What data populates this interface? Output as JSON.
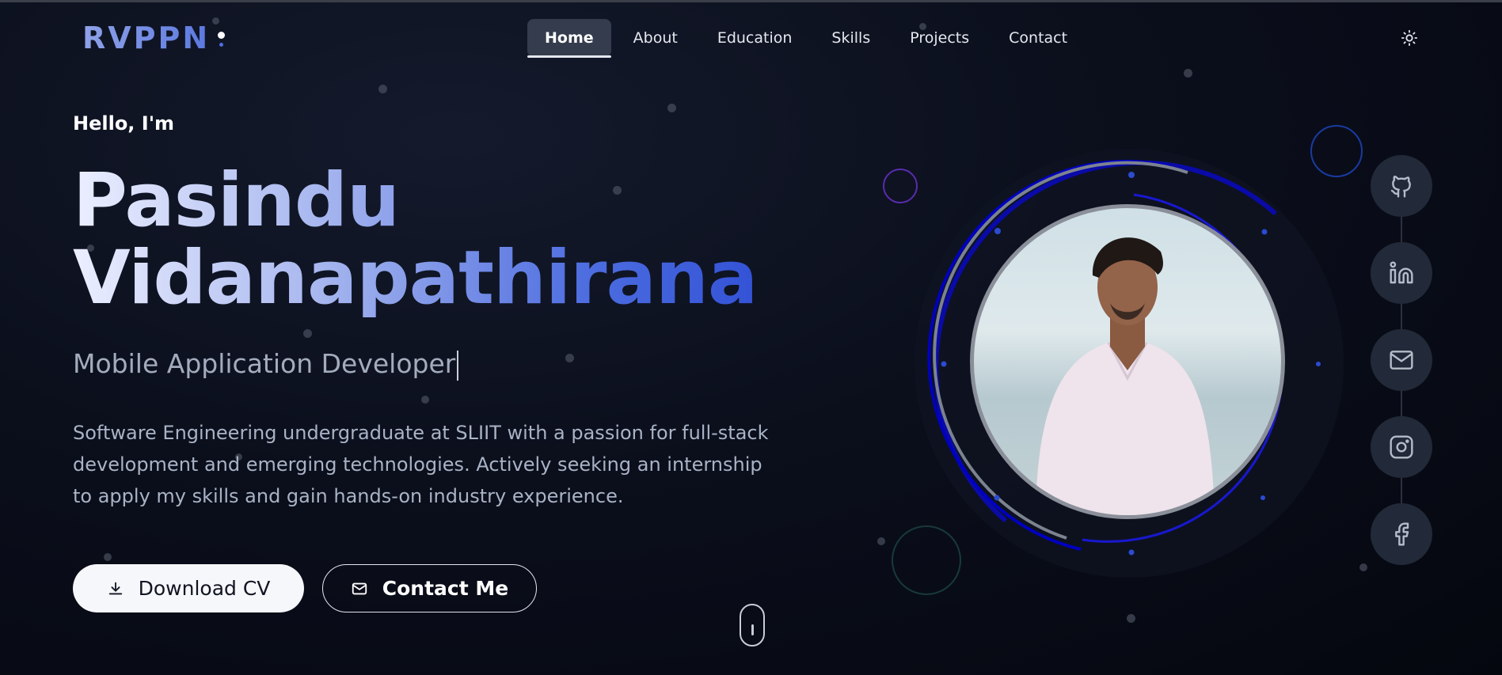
{
  "brand": {
    "logo_text": "RVPPN"
  },
  "nav": {
    "items": [
      {
        "label": "Home",
        "active": true
      },
      {
        "label": "About",
        "active": false
      },
      {
        "label": "Education",
        "active": false
      },
      {
        "label": "Skills",
        "active": false
      },
      {
        "label": "Projects",
        "active": false
      },
      {
        "label": "Contact",
        "active": false
      }
    ],
    "theme_toggle_icon": "sun-icon"
  },
  "hero": {
    "greeting": "Hello, I'm",
    "name_line1": "Pasindu",
    "name_line2": "Vidanapathirana",
    "role": "Mobile Application Developer",
    "bio": "Software Engineering undergraduate at SLIIT with a passion for full-stack development and emerging technologies. Actively seeking an internship to apply my skills and gain hands-on industry experience.",
    "download_label": "Download CV",
    "download_icon": "download-icon",
    "contact_label": "Contact Me",
    "contact_icon": "mail-icon"
  },
  "profile": {
    "photo_icon": "profile-photo"
  },
  "socials": [
    {
      "name": "github",
      "icon": "github-icon"
    },
    {
      "name": "linkedin",
      "icon": "linkedin-icon"
    },
    {
      "name": "email",
      "icon": "mail-icon"
    },
    {
      "name": "instagram",
      "icon": "instagram-icon"
    },
    {
      "name": "facebook",
      "icon": "facebook-icon"
    }
  ],
  "colors": {
    "background": "#0b0f1c",
    "accent_blue": "#3352d6",
    "ring_blue": "#1010c8",
    "text_muted": "#a9b3c5",
    "nav_active_bg": "#343c4d",
    "social_bg": "#222a39"
  },
  "scroll_indicator_icon": "mouse-scroll-icon"
}
